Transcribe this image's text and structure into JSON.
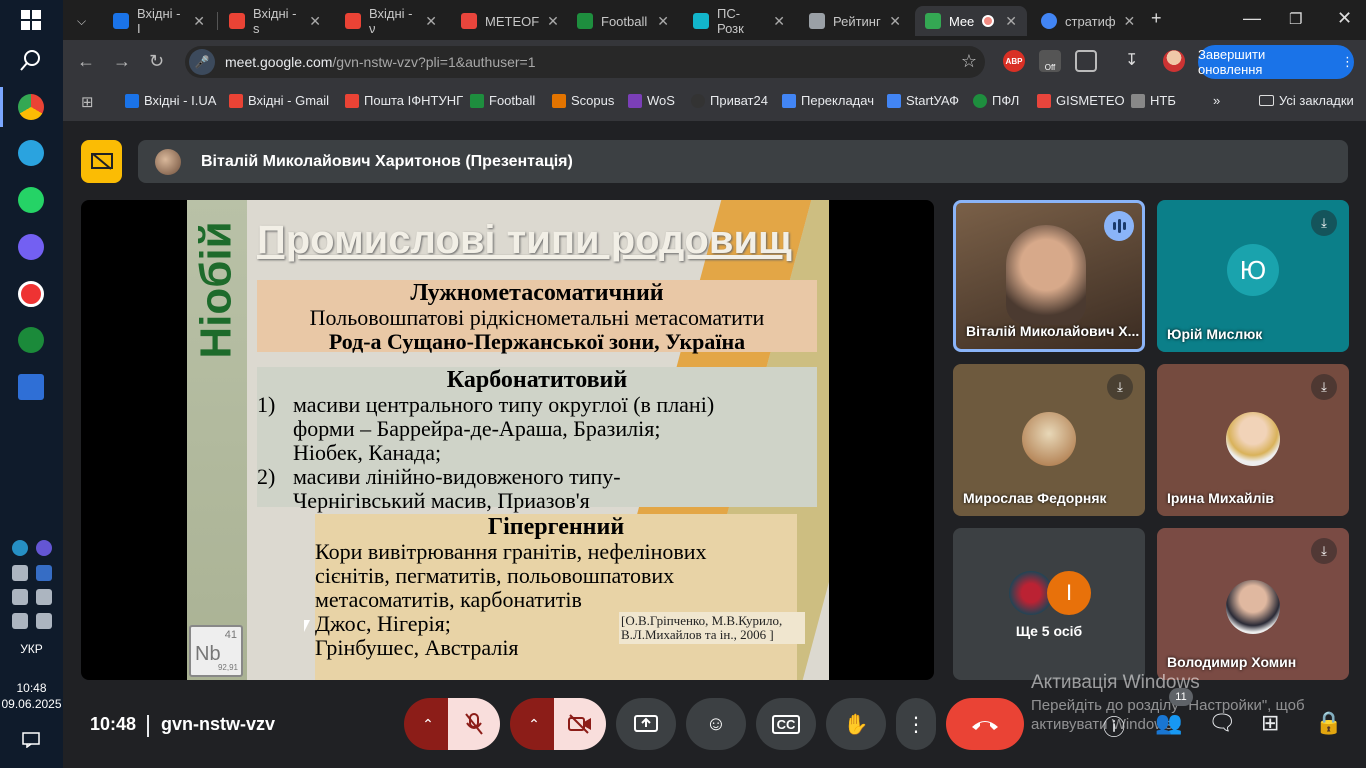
{
  "taskbar": {
    "lang": "УКР",
    "time": "10:48",
    "date": "09.06.2025"
  },
  "tabs": [
    {
      "label": "Вхідні - I",
      "color": "#1a73e8"
    },
    {
      "label": "Вхідні - s",
      "color": "#ea4335"
    },
    {
      "label": "Вхідні - ν",
      "color": "#ea4335"
    },
    {
      "label": "METEOF",
      "color": "#e8453c"
    },
    {
      "label": "Football",
      "color": "#1e8e3e"
    },
    {
      "label": "ПС-Розк",
      "color": "#12b5cb"
    },
    {
      "label": "Рейтинг",
      "color": "#9aa0a6"
    },
    {
      "label": "Mee",
      "color": "#34a853"
    },
    {
      "label": "стратиф",
      "color": "#4285f4"
    }
  ],
  "toolbar": {
    "url_host": "meet.google.com",
    "url_path": "/gvn-nstw-vzv?pli=1&authuser=1",
    "ext_abv": "ABP",
    "ext_off": "Off",
    "update_label": "Завершити оновлення"
  },
  "bookmarks": [
    {
      "label": "Вхідні - I.UA",
      "color": "#1a73e8"
    },
    {
      "label": "Вхідні - Gmail",
      "color": "#ea4335"
    },
    {
      "label": "Пошта ІФНТУНГ",
      "color": "#ea4335"
    },
    {
      "label": "Football",
      "color": "#1e8e3e"
    },
    {
      "label": "Scopus",
      "color": "#e37400"
    },
    {
      "label": "WoS",
      "color": "#7b3fb8"
    },
    {
      "label": "Приват24",
      "color": "#333333"
    },
    {
      "label": "Перекладач",
      "color": "#4285f4"
    },
    {
      "label": "StartУАФ",
      "color": "#4285f4"
    },
    {
      "label": "ПФЛ",
      "color": "#1e8e3e"
    },
    {
      "label": "GISMETEO",
      "color": "#e8453c"
    },
    {
      "label": "НТБ",
      "color": "#888888"
    }
  ],
  "bookmarks_all": "Усі закладки",
  "presenter": {
    "name": "Віталій Миколайович Харитонов (Презентація)"
  },
  "slide": {
    "side_label": "Ніобій",
    "nb_symbol": "Nb",
    "nb_number": "41",
    "nb_mass": "92,91",
    "title": "Промислові типи родовищ",
    "box1": {
      "heading": "Лужнометасоматичний",
      "line1": "Польовошпатові рідкіснометальні метасоматити",
      "line2": "Род-а Сущано-Пержанської зони, Україна"
    },
    "box2": {
      "heading": "Карбонатитовий",
      "item1_num": "1)",
      "item1_a": "масиви центрального типу округлої (в плані)",
      "item1_b": "форми – Баррейра-де-Араша, Бразилія;",
      "item1_c": "Ніобек, Канада;",
      "item2_num": "2)",
      "item2_a": "масиви лінійно-видовженого типу-",
      "item2_b": "Чернігівський масив, Приазов'я"
    },
    "box3": {
      "heading": "Гіпергенний",
      "line1": "Кори вивітрювання гранітів, нефелінових",
      "line2": "сієнітів, пегматитів, польовошпатових",
      "line3": "метасоматитів, карбонатитів",
      "line4": "Джос, Нігерія;",
      "line5": "Грінбушес, Австралія"
    },
    "reference": "[О.В.Гріпченко, М.В.Курило, В.Л.Михайлов та ін., 2006 ]"
  },
  "participants": [
    {
      "name": "Віталій Миколайович Х...",
      "bg": "#5a4636"
    },
    {
      "name": "Юрій Мислюк",
      "initial": "Ю",
      "bg": "#0b7f89"
    },
    {
      "name": "Мирослав Федорняк",
      "bg": "#6e5a3e"
    },
    {
      "name": "Ірина Михайлів",
      "bg": "#754b3f"
    },
    {
      "name": "Ще 5 осіб",
      "bg": "#3c4043",
      "extra_initial": "І"
    },
    {
      "name": "Володимир Хомин",
      "bg": "#7a4b44"
    }
  ],
  "bottom": {
    "time": "10:48",
    "meeting_code": "gvn-nstw-vzv",
    "people_count": "11"
  },
  "windows_activation": {
    "title": "Активація Windows",
    "text": "Перейдіть до розділу \"Настройки\", щоб активувати Windows."
  }
}
